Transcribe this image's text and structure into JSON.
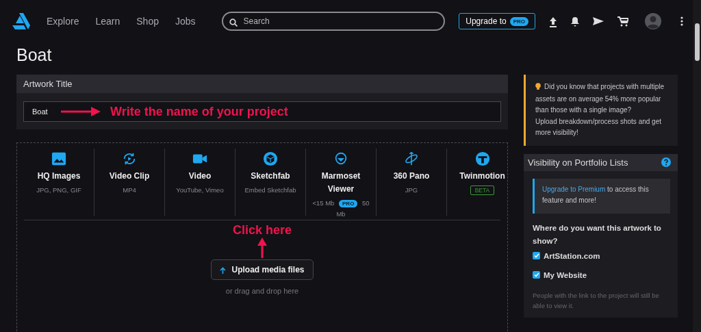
{
  "header": {
    "nav": [
      "Explore",
      "Learn",
      "Shop",
      "Jobs"
    ],
    "search": {
      "placeholder": "Search"
    },
    "upgrade": {
      "label": "Upgrade to",
      "badge": "PRO"
    }
  },
  "page_title": "Boat",
  "artwork_title": {
    "heading": "Artwork Title",
    "value": "Boat",
    "annotation": "Write the name of your project"
  },
  "media_types": [
    {
      "kind": "image",
      "name": "HQ Images",
      "sub": [
        "JPG, PNG, GIF"
      ]
    },
    {
      "kind": "clip",
      "name": "Video Clip",
      "sub": [
        "MP4"
      ]
    },
    {
      "kind": "video",
      "name": "Video",
      "sub": [
        "YouTube, Vimeo"
      ]
    },
    {
      "kind": "sketchfab",
      "name": "Sketchfab",
      "sub": [
        "Embed Sketchfab"
      ]
    },
    {
      "kind": "marmoset",
      "name": "Marmoset Viewer",
      "sub": [
        "<15 Mb"
      ],
      "badge": "PRO",
      "sub_after": "50 Mb"
    },
    {
      "kind": "pano",
      "name": "360 Pano",
      "sub": [
        "JPG"
      ]
    },
    {
      "kind": "twinmotion",
      "name": "Twinmotion",
      "tag": "BETA"
    }
  ],
  "upload": {
    "annotation": "Click here",
    "button": "Upload media files",
    "hint": "or drag and drop here"
  },
  "tip": {
    "lines": [
      "Did you know that projects with multiple assets are on average 54% more popular than those with a single image?",
      "Upload breakdown/process shots and get more visibility!"
    ]
  },
  "visibility": {
    "heading": "Visibility on Portfolio Lists",
    "upsell_link": "Upgrade to Premium",
    "upsell_text": " to access this feature and more!",
    "question": "Where do you want this artwork to show?",
    "options": [
      {
        "label": "ArtStation.com",
        "checked": true
      },
      {
        "label": "My Website",
        "checked": true
      }
    ],
    "note": "People with the link to the project will still be able to view it."
  }
}
